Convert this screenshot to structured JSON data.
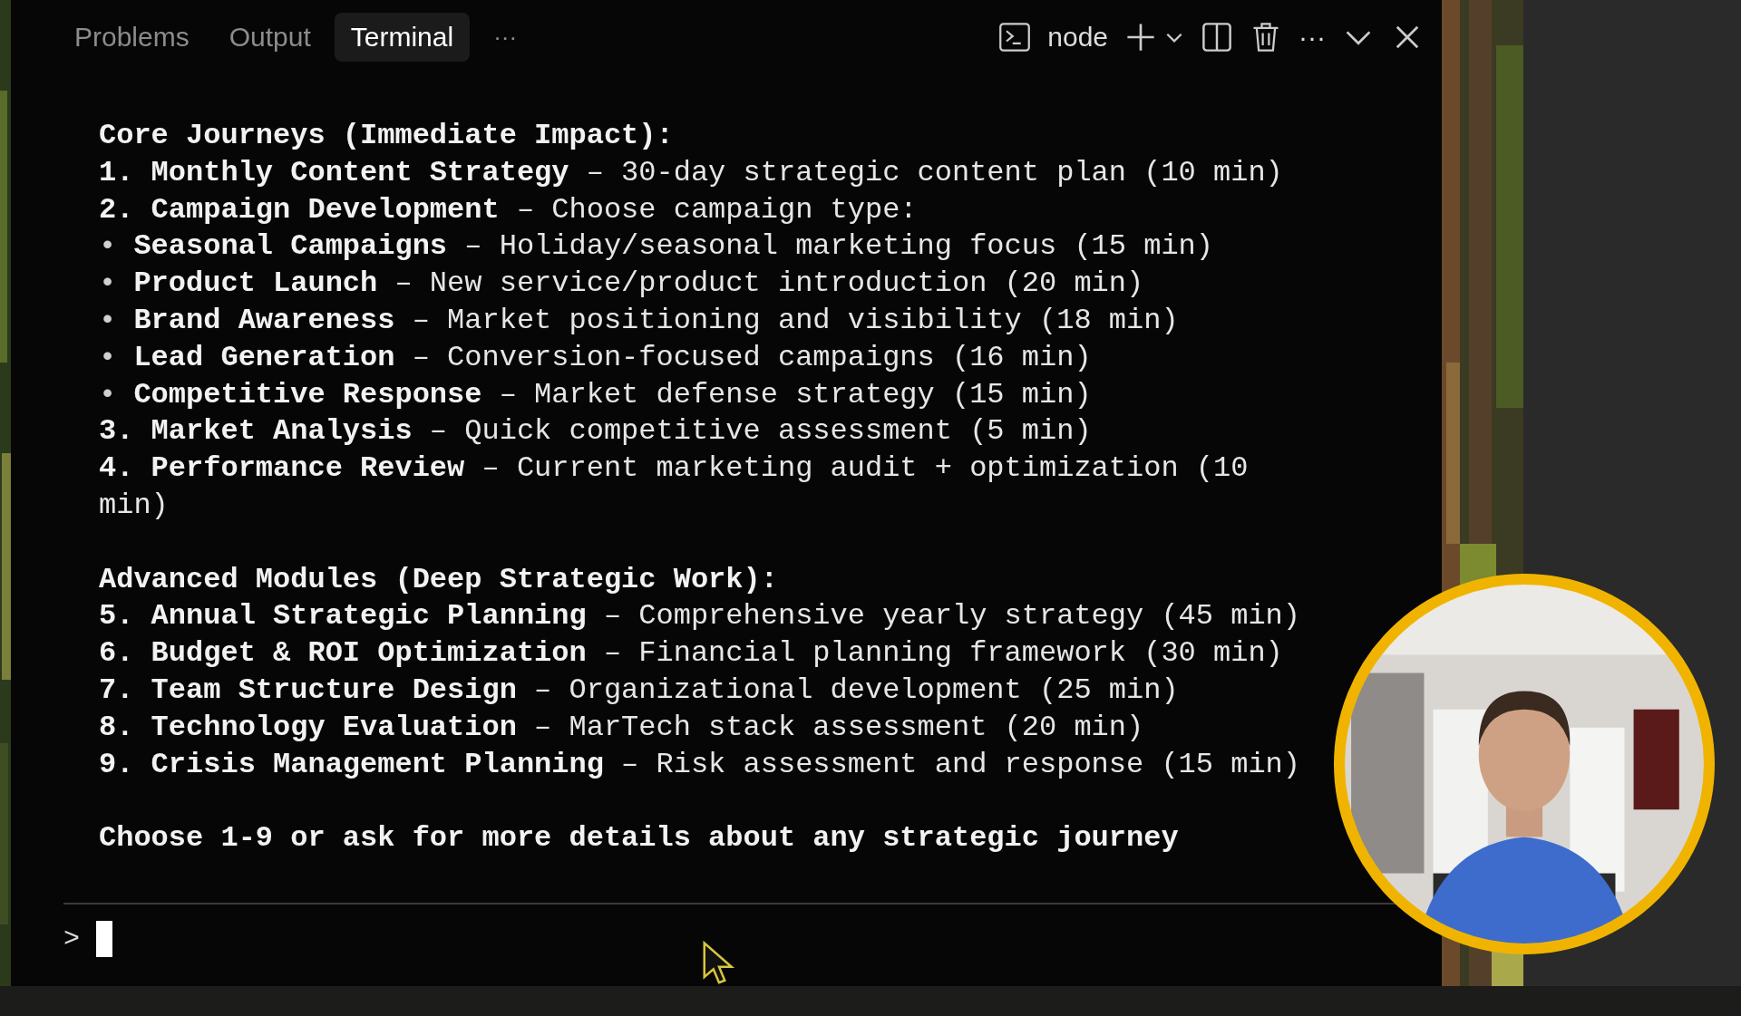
{
  "panel_tabs": [
    {
      "label": "Problems",
      "selected": false
    },
    {
      "label": "Output",
      "selected": false
    },
    {
      "label": "Terminal",
      "selected": true
    }
  ],
  "tabs_overflow": "···",
  "terminal_toolbar": {
    "shell": "node",
    "more": "···"
  },
  "sections": [
    {
      "heading": "Core Journeys (Immediate Impact):",
      "items": [
        {
          "kind": "numbered",
          "marker": "1.",
          "title": "Monthly Content Strategy",
          "description": "– 30-day strategic content plan (10 min)"
        },
        {
          "kind": "numbered",
          "marker": "2.",
          "title": "Campaign Development",
          "description": "– Choose campaign type:"
        },
        {
          "kind": "bullet",
          "marker": "•",
          "title": "Seasonal Campaigns",
          "description": "– Holiday/seasonal marketing focus (15 min)"
        },
        {
          "kind": "bullet",
          "marker": "•",
          "title": "Product Launch",
          "description": "– New service/product introduction (20 min)"
        },
        {
          "kind": "bullet",
          "marker": "•",
          "title": "Brand Awareness",
          "description": "– Market positioning and visibility (18 min)"
        },
        {
          "kind": "bullet",
          "marker": "•",
          "title": "Lead Generation",
          "description": "– Conversion-focused campaigns (16 min)"
        },
        {
          "kind": "bullet",
          "marker": "•",
          "title": "Competitive Response",
          "description": "– Market defense strategy (15 min)"
        },
        {
          "kind": "numbered",
          "marker": "3.",
          "title": "Market Analysis",
          "description": "– Quick competitive assessment (5 min)"
        },
        {
          "kind": "numbered",
          "marker": "4.",
          "title": "Performance Review",
          "description": "– Current marketing audit + optimization (10 min)"
        }
      ]
    },
    {
      "heading": "Advanced Modules (Deep Strategic Work):",
      "items": [
        {
          "kind": "numbered",
          "marker": "5.",
          "title": "Annual Strategic Planning",
          "description": "– Comprehensive yearly strategy (45 min)"
        },
        {
          "kind": "numbered",
          "marker": "6.",
          "title": "Budget & ROI Optimization",
          "description": "– Financial planning framework (30 min)"
        },
        {
          "kind": "numbered",
          "marker": "7.",
          "title": "Team Structure Design",
          "description": "– Organizational development (25 min)"
        },
        {
          "kind": "numbered",
          "marker": "8.",
          "title": "Technology Evaluation",
          "description": "– MarTech stack assessment (20 min)"
        },
        {
          "kind": "numbered",
          "marker": "9.",
          "title": "Crisis Management Planning",
          "description": "– Risk assessment and response (15 min)"
        }
      ]
    }
  ],
  "closing": "Choose 1-9 or ask for more details about any strategic journey",
  "input": {
    "prompt": ">"
  }
}
